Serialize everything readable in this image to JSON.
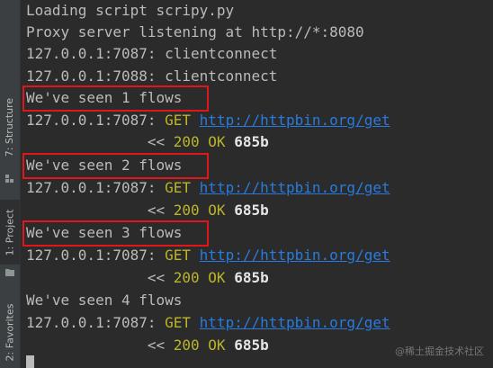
{
  "sidebar": {
    "tabs": [
      {
        "label": "7: Structure",
        "icon": "structure-icon"
      },
      {
        "label": "1: Project",
        "icon": "folder-icon"
      },
      {
        "label": "2: Favorites",
        "icon": "star-icon"
      }
    ]
  },
  "console": {
    "lines": [
      {
        "text": "Loading script scripy.py"
      },
      {
        "text": "Proxy server listening at http://*:8080"
      },
      {
        "text": "127.0.0.1:7087: clientconnect"
      },
      {
        "text": "127.0.0.1:7088: clientconnect"
      },
      {
        "text": "We've seen 1 flows"
      },
      {
        "ip": "127.0.0.1:7087: ",
        "method": "GET",
        "url": "http://httpbin.org/get"
      },
      {
        "prefix": "<< ",
        "code": "200 OK",
        "size": "685b"
      },
      {
        "text": "We've seen 2 flows"
      },
      {
        "ip": "127.0.0.1:7087: ",
        "method": "GET",
        "url": "http://httpbin.org/get"
      },
      {
        "prefix": "<< ",
        "code": "200 OK",
        "size": "685b"
      },
      {
        "text": "We've seen 3 flows"
      },
      {
        "ip": "127.0.0.1:7087: ",
        "method": "GET",
        "url": "http://httpbin.org/get"
      },
      {
        "prefix": "<< ",
        "code": "200 OK",
        "size": "685b"
      },
      {
        "text": "We've seen 4 flows"
      },
      {
        "ip": "127.0.0.1:7087: ",
        "method": "GET",
        "url": "http://httpbin.org/get"
      },
      {
        "prefix": "<< ",
        "code": "200 OK",
        "size": "685b"
      }
    ]
  },
  "watermark": "@稀土掘金技术社区",
  "colors": {
    "highlight": "#e0161b",
    "method": "#bbb529",
    "url": "#287bde",
    "background": "#2b2b2b"
  }
}
